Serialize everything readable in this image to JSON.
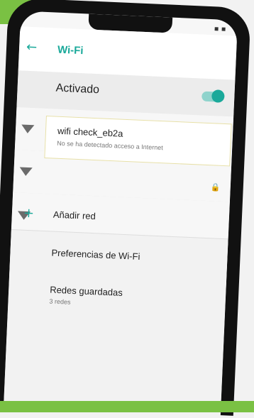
{
  "appbar": {
    "title": "Wi-Fi",
    "back_icon": "arrow-left-icon"
  },
  "wifi_toggle": {
    "label": "Activado",
    "state": "on"
  },
  "networks": [
    {
      "name": "",
      "secured": true
    },
    {
      "name": "",
      "secured": true
    },
    {
      "name": "wifi check_eb2a",
      "status": "No se ha detectado acceso a Internet",
      "secured": false,
      "highlighted": true
    },
    {
      "name": "",
      "secured": true
    }
  ],
  "add_network": {
    "label": "Añadir red"
  },
  "preferences": {
    "wifi_prefs": "Preferencias de Wi-Fi",
    "saved_networks": "Redes guardadas",
    "saved_networks_count": "3 redes"
  },
  "colors": {
    "accent": "#1aa99a",
    "brand_green": "#7ac143"
  }
}
